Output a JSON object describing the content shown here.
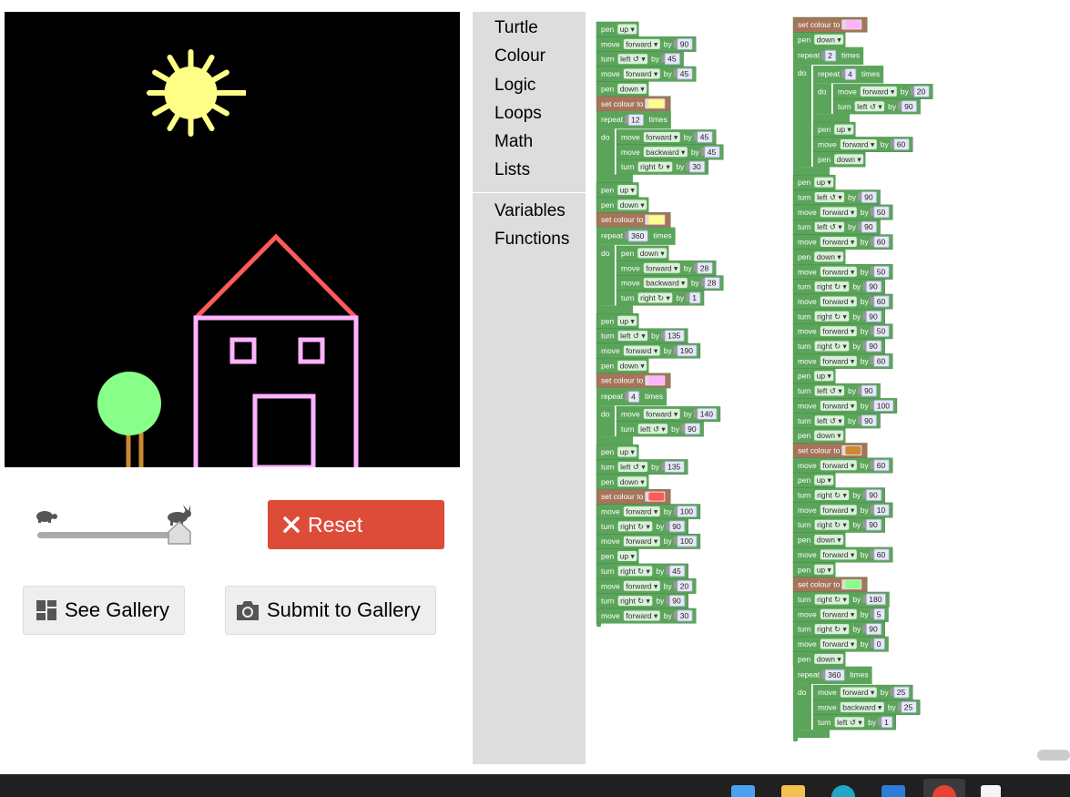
{
  "controls": {
    "reset_label": "Reset",
    "gallery_label": "See Gallery",
    "submit_label": "Submit to Gallery",
    "speed": 1.0
  },
  "toolbox": {
    "categories": [
      "Turtle",
      "Colour",
      "Logic",
      "Loops",
      "Math",
      "Lists",
      "Variables",
      "Functions"
    ]
  },
  "drawing": {
    "colors": {
      "background": "#000000",
      "sun": "#ffff88",
      "roof": "#ff5a5a",
      "house": "#ffb3ff",
      "tree": "#88ff88",
      "trunk": "#cc8833"
    }
  },
  "program": {
    "columns": [
      [
        {
          "cmd": "pen",
          "opt": "up"
        },
        {
          "cmd": "move",
          "opt": "forward",
          "num": "90"
        },
        {
          "cmd": "turn",
          "opt": "left ↺",
          "num": "45"
        },
        {
          "cmd": "move",
          "opt": "forward",
          "num": "45"
        },
        {
          "cmd": "pen",
          "opt": "down"
        },
        {
          "cmd": "set colour to",
          "color": "#ffff88"
        },
        {
          "cmd": "repeat",
          "num": "12",
          "body": [
            {
              "cmd": "move",
              "opt": "forward",
              "num": "45"
            },
            {
              "cmd": "move",
              "opt": "backward",
              "num": "45"
            },
            {
              "cmd": "turn",
              "opt": "right ↻",
              "num": "30"
            }
          ]
        },
        {
          "cmd": "pen",
          "opt": "up"
        },
        {
          "cmd": "pen",
          "opt": "down"
        },
        {
          "cmd": "set colour to",
          "color": "#ffff88"
        },
        {
          "cmd": "repeat",
          "num": "360",
          "body": [
            {
              "cmd": "pen",
              "opt": "down"
            },
            {
              "cmd": "move",
              "opt": "forward",
              "num": "28"
            },
            {
              "cmd": "move",
              "opt": "backward",
              "num": "28"
            },
            {
              "cmd": "turn",
              "opt": "right ↻",
              "num": "1"
            }
          ]
        },
        {
          "cmd": "pen",
          "opt": "up"
        },
        {
          "cmd": "turn",
          "opt": "left ↺",
          "num": "135"
        },
        {
          "cmd": "move",
          "opt": "forward",
          "num": "190"
        },
        {
          "cmd": "pen",
          "opt": "down"
        },
        {
          "cmd": "set colour to",
          "color": "#ffb3ff"
        },
        {
          "cmd": "repeat",
          "num": "4",
          "body": [
            {
              "cmd": "move",
              "opt": "forward",
              "num": "140"
            },
            {
              "cmd": "turn",
              "opt": "left ↺",
              "num": "90"
            }
          ]
        },
        {
          "cmd": "pen",
          "opt": "up"
        },
        {
          "cmd": "turn",
          "opt": "left ↺",
          "num": "135"
        },
        {
          "cmd": "pen",
          "opt": "down"
        },
        {
          "cmd": "set colour to",
          "color": "#ff5a5a"
        },
        {
          "cmd": "move",
          "opt": "forward",
          "num": "100"
        },
        {
          "cmd": "turn",
          "opt": "right ↻",
          "num": "90"
        },
        {
          "cmd": "move",
          "opt": "forward",
          "num": "100"
        },
        {
          "cmd": "pen",
          "opt": "up"
        },
        {
          "cmd": "turn",
          "opt": "right ↻",
          "num": "45"
        },
        {
          "cmd": "move",
          "opt": "forward",
          "num": "20"
        },
        {
          "cmd": "turn",
          "opt": "right ↻",
          "num": "90"
        },
        {
          "cmd": "move",
          "opt": "forward",
          "num": "30"
        }
      ],
      [
        {
          "cmd": "set colour to",
          "color": "#ffb3ff"
        },
        {
          "cmd": "pen",
          "opt": "down"
        },
        {
          "cmd": "repeat",
          "num": "2",
          "body": [
            {
              "cmd": "repeat",
              "num": "4",
              "body": [
                {
                  "cmd": "move",
                  "opt": "forward",
                  "num": "20"
                },
                {
                  "cmd": "turn",
                  "opt": "left ↺",
                  "num": "90"
                }
              ]
            },
            {
              "cmd": "pen",
              "opt": "up"
            },
            {
              "cmd": "move",
              "opt": "forward",
              "num": "60"
            },
            {
              "cmd": "pen",
              "opt": "down"
            }
          ]
        },
        {
          "cmd": "pen",
          "opt": "up"
        },
        {
          "cmd": "turn",
          "opt": "left ↺",
          "num": "90"
        },
        {
          "cmd": "move",
          "opt": "forward",
          "num": "50"
        },
        {
          "cmd": "turn",
          "opt": "left ↺",
          "num": "90"
        },
        {
          "cmd": "move",
          "opt": "forward",
          "num": "60"
        },
        {
          "cmd": "pen",
          "opt": "down"
        },
        {
          "cmd": "move",
          "opt": "forward",
          "num": "50"
        },
        {
          "cmd": "turn",
          "opt": "right ↻",
          "num": "90"
        },
        {
          "cmd": "move",
          "opt": "forward",
          "num": "60"
        },
        {
          "cmd": "turn",
          "opt": "right ↻",
          "num": "90"
        },
        {
          "cmd": "move",
          "opt": "forward",
          "num": "50"
        },
        {
          "cmd": "turn",
          "opt": "right ↻",
          "num": "90"
        },
        {
          "cmd": "move",
          "opt": "forward",
          "num": "60"
        },
        {
          "cmd": "pen",
          "opt": "up"
        },
        {
          "cmd": "turn",
          "opt": "left ↺",
          "num": "90"
        },
        {
          "cmd": "move",
          "opt": "forward",
          "num": "100"
        },
        {
          "cmd": "turn",
          "opt": "left ↺",
          "num": "90"
        },
        {
          "cmd": "pen",
          "opt": "down"
        },
        {
          "cmd": "set colour to",
          "color": "#cc8833"
        },
        {
          "cmd": "move",
          "opt": "forward",
          "num": "60"
        },
        {
          "cmd": "pen",
          "opt": "up"
        },
        {
          "cmd": "turn",
          "opt": "right ↻",
          "num": "90"
        },
        {
          "cmd": "move",
          "opt": "forward",
          "num": "10"
        },
        {
          "cmd": "turn",
          "opt": "right ↻",
          "num": "90"
        },
        {
          "cmd": "pen",
          "opt": "down"
        },
        {
          "cmd": "move",
          "opt": "forward",
          "num": "60"
        },
        {
          "cmd": "pen",
          "opt": "up"
        },
        {
          "cmd": "set colour to",
          "color": "#88ff88"
        },
        {
          "cmd": "turn",
          "opt": "right ↻",
          "num": "180"
        },
        {
          "cmd": "move",
          "opt": "forward",
          "num": "5"
        },
        {
          "cmd": "turn",
          "opt": "right ↻",
          "num": "90"
        },
        {
          "cmd": "move",
          "opt": "forward",
          "num": "0"
        },
        {
          "cmd": "pen",
          "opt": "down"
        },
        {
          "cmd": "repeat",
          "num": "360",
          "body": [
            {
              "cmd": "move",
              "opt": "forward",
              "num": "25"
            },
            {
              "cmd": "move",
              "opt": "backward",
              "num": "25"
            },
            {
              "cmd": "turn",
              "opt": "left ↺",
              "num": "1"
            }
          ]
        }
      ]
    ],
    "labels": {
      "by": "by",
      "times": "times",
      "do": "do"
    }
  }
}
